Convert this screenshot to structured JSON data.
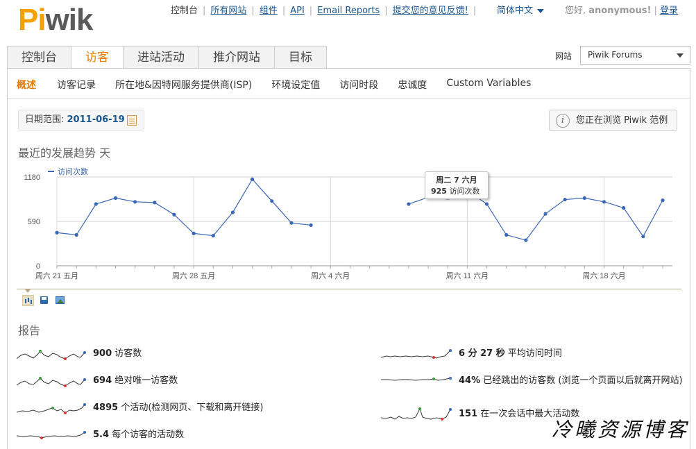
{
  "logo": {
    "part1": "Pi",
    "part2": "wik"
  },
  "top_links": {
    "dashboard": "控制台",
    "all_websites": "所有网站",
    "widgets": "组件",
    "api": "API",
    "email_reports": "Email Reports",
    "feedback": "提交您的意见反馈!",
    "language": "简体中文"
  },
  "user": {
    "greeting": "您好,",
    "name": "anonymous!",
    "login": "登录"
  },
  "main_tabs": [
    {
      "label": "控制台",
      "active": false
    },
    {
      "label": "访客",
      "active": true
    },
    {
      "label": "进站活动",
      "active": false
    },
    {
      "label": "推介网站",
      "active": false
    },
    {
      "label": "目标",
      "active": false
    }
  ],
  "site_selector": {
    "label": "网站",
    "value": "Piwik Forums"
  },
  "sub_nav": [
    {
      "label": "概述",
      "active": true
    },
    {
      "label": "访客记录",
      "active": false
    },
    {
      "label": "所在地&因特网服务提供商(ISP)",
      "active": false
    },
    {
      "label": "环境设定值",
      "active": false
    },
    {
      "label": "访问时段",
      "active": false
    },
    {
      "label": "忠诚度",
      "active": false
    },
    {
      "label": "Custom Variables",
      "active": false
    }
  ],
  "date_range": {
    "label": "日期范围: ",
    "value": "2011-06-19"
  },
  "demo_notice": "您正在浏览 Piwik 范例",
  "evolution_title": "最近的发展趋势 天",
  "tooltip": {
    "line1": "周二 7 六月",
    "value": "925",
    "unit": "访问次数"
  },
  "chart_data": {
    "type": "line",
    "series": [
      {
        "name": "访问次数",
        "color": "#3a67b7",
        "values": [
          440,
          410,
          820,
          900,
          850,
          840,
          680,
          430,
          400,
          710,
          1150,
          860,
          570,
          540,
          null,
          null,
          null,
          null,
          820,
          910,
          925,
          1000,
          820,
          410,
          340,
          690,
          880,
          900,
          850,
          770,
          390,
          870
        ]
      }
    ],
    "x_ticks": [
      "周六 21 五月",
      "周六 28 五月",
      "周六 4 六月",
      "周六 11 六月",
      "周六 18 六月"
    ],
    "x_tick_index": [
      0,
      7,
      14,
      21,
      28
    ],
    "y_ticks": [
      "0",
      "590",
      "1180"
    ],
    "ylim": [
      0,
      1180
    ],
    "grid": true,
    "legend_position": "top-left"
  },
  "reports_title": "报告",
  "reports_left": [
    {
      "value": "900",
      "text": " 访客数"
    },
    {
      "value": "694",
      "text": " 绝对唯一访客数"
    },
    {
      "value": "4895",
      "text": " 个活动(检测网页、下载和离开链接)"
    },
    {
      "value": "5.4",
      "text": " 每个访客的活动数"
    }
  ],
  "reports_right": [
    {
      "value": "6 分 27 秒",
      "text": " 平均访问时间"
    },
    {
      "value": "44%",
      "text": " 已经跳出的访客数 (浏览一个页面以后就离开网站)"
    },
    {
      "value": "151",
      "text": " 在一次会话中最大活动数"
    }
  ],
  "watermark": "冷曦资源博客",
  "icons": [
    "calendar-icon",
    "info-icon",
    "chart-bar-icon",
    "save-icon",
    "image-icon",
    "dropdown-caret-icon"
  ]
}
